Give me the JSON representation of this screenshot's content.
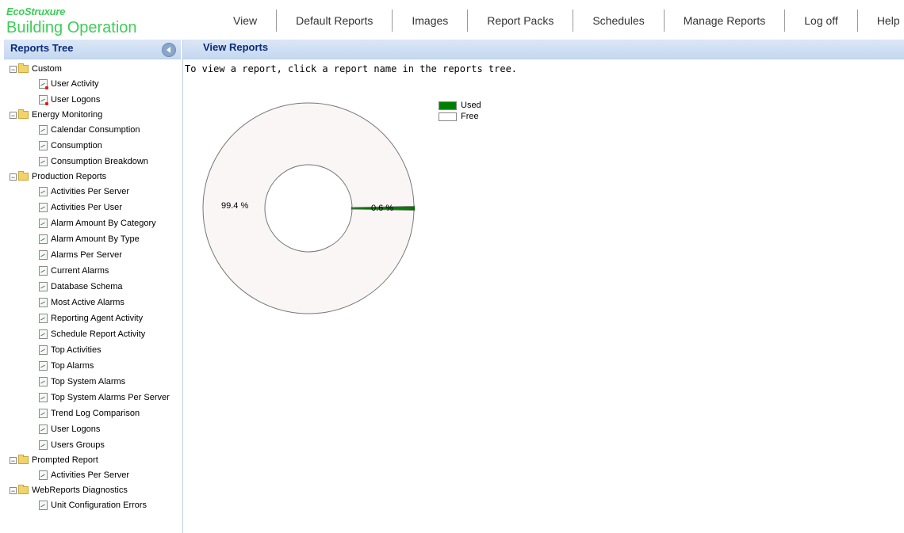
{
  "brand": {
    "line1": "EcoStruxure",
    "line2": "Building Operation",
    "color": "#3dcd58"
  },
  "nav": [
    {
      "label": "View",
      "name": "nav-view"
    },
    {
      "label": "Default Reports",
      "name": "nav-default-reports"
    },
    {
      "label": "Images",
      "name": "nav-images"
    },
    {
      "label": "Report Packs",
      "name": "nav-report-packs"
    },
    {
      "label": "Schedules",
      "name": "nav-schedules"
    },
    {
      "label": "Manage Reports",
      "name": "nav-manage-reports"
    },
    {
      "label": "Log off",
      "name": "nav-log-off"
    },
    {
      "label": "Help",
      "name": "nav-help"
    }
  ],
  "sidebar": {
    "title": "Reports Tree",
    "collapse_icon": "chevron-left-icon",
    "folders": [
      {
        "label": "Custom",
        "expander": "⊟",
        "items": [
          {
            "label": "User Activity",
            "icon": "custom-report-icon"
          },
          {
            "label": "User Logons",
            "icon": "custom-report-icon"
          }
        ]
      },
      {
        "label": "Energy Monitoring",
        "expander": "⊟",
        "items": [
          {
            "label": "Calendar Consumption",
            "icon": "report-icon"
          },
          {
            "label": "Consumption",
            "icon": "report-icon"
          },
          {
            "label": "Consumption Breakdown",
            "icon": "report-icon"
          }
        ]
      },
      {
        "label": "Production Reports",
        "expander": "⊟",
        "items": [
          {
            "label": "Activities Per Server",
            "icon": "report-icon"
          },
          {
            "label": "Activities Per User",
            "icon": "report-icon"
          },
          {
            "label": "Alarm Amount By Category",
            "icon": "report-icon"
          },
          {
            "label": "Alarm Amount By Type",
            "icon": "report-icon"
          },
          {
            "label": "Alarms Per Server",
            "icon": "report-icon"
          },
          {
            "label": "Current Alarms",
            "icon": "report-icon"
          },
          {
            "label": "Database Schema",
            "icon": "report-icon"
          },
          {
            "label": "Most Active Alarms",
            "icon": "report-icon"
          },
          {
            "label": "Reporting Agent Activity",
            "icon": "report-icon"
          },
          {
            "label": "Schedule Report Activity",
            "icon": "report-icon"
          },
          {
            "label": "Top Activities",
            "icon": "report-icon"
          },
          {
            "label": "Top Alarms",
            "icon": "report-icon"
          },
          {
            "label": "Top System Alarms",
            "icon": "report-icon"
          },
          {
            "label": "Top System Alarms Per Server",
            "icon": "report-icon"
          },
          {
            "label": "Trend Log Comparison",
            "icon": "report-icon"
          },
          {
            "label": "User Logons",
            "icon": "report-icon"
          },
          {
            "label": "Users Groups",
            "icon": "report-icon"
          }
        ]
      },
      {
        "label": "Prompted Report",
        "expander": "⊟",
        "items": [
          {
            "label": "Activities Per Server",
            "icon": "report-icon"
          }
        ]
      },
      {
        "label": "WebReports Diagnostics",
        "expander": "⊟",
        "items": [
          {
            "label": "Unit Configuration Errors",
            "icon": "report-icon"
          }
        ]
      }
    ]
  },
  "main": {
    "title": "View Reports",
    "instruction": "To view a report, click a report name in the reports tree."
  },
  "chart_data": {
    "type": "pie",
    "donut": true,
    "slices": [
      {
        "name": "Used",
        "value": 0.6,
        "label": "0.6 %",
        "color": "#008000"
      },
      {
        "name": "Free",
        "value": 99.4,
        "label": "99.4 %",
        "color": "#faf6f6"
      }
    ],
    "legend": {
      "placement": "top-right",
      "entries": [
        "Used",
        "Free"
      ]
    }
  }
}
